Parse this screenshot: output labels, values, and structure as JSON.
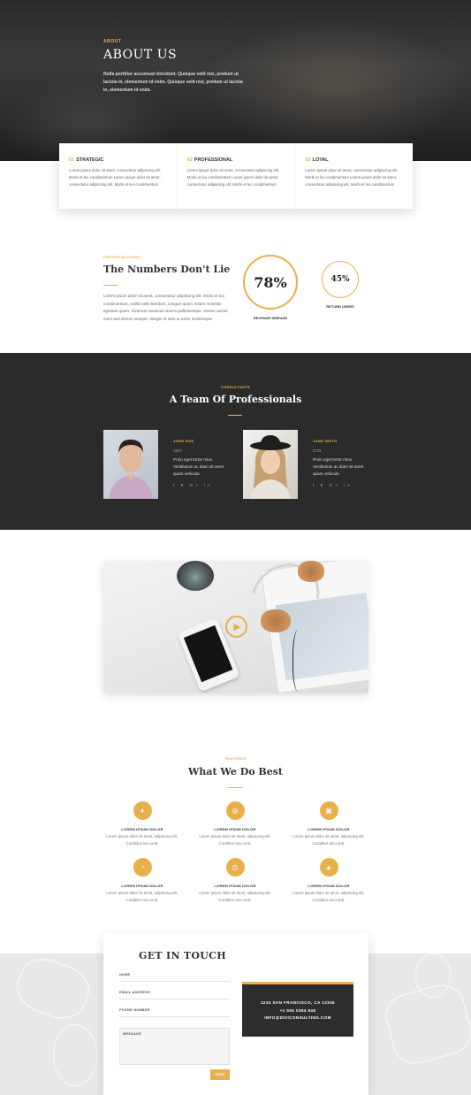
{
  "hero": {
    "eyebrow": "ABOUT",
    "title": "ABOUT US",
    "lead": "Nulla porttitor accumsan tincidunt. Quisque velit nisi, pretium ut lacinia in, elementum id enim. Quisque velit nisi, pretium ut lacinia in, elementum id enim."
  },
  "values": [
    {
      "num": "01",
      "title": "STRATEGIC",
      "body": "Lorem ipsum dolor sit amet, consectetur adipiscing elit. Morbi et leo condimentum Lorem ipsum dolor sit amet, consectetur adipiscing elit. Morbi et leo condimentum"
    },
    {
      "num": "02",
      "title": "PROFESSIONAL",
      "body": "Lorem ipsum dolor sit amet, consectetur adipiscing elit. Morbi et leo condimentum Lorem ipsum dolor sit amet, consectetur adipiscing elit. Morbi et leo condimentum"
    },
    {
      "num": "03",
      "title": "LOYAL",
      "body": "Lorem ipsum dolor sit amet, consectetur adipiscing elit. Morbi et leo condimentum Lorem ipsum dolor sit amet, consectetur adipiscing elit. Morbi et leo condimentum"
    }
  ],
  "numbers": {
    "eyebrow": "PROVEN SUCCESS",
    "title": "The Numbers Don't Lie",
    "body": "Lorem ipsum dolor sit amet, consectetur adipiscing elit. Morbi et leo condimentum, mollis velit interdum, congue quam. Etiam molestie egestas quam. Vivamus maximus viverra pellentesque. Donec auctor enim sed dictum semper. Integer id sem ut tortor scelerisque",
    "stats": [
      {
        "value": "78%",
        "label": "REVENUE INREASE"
      },
      {
        "value": "45%",
        "label": "RETURN USERS"
      }
    ]
  },
  "team": {
    "eyebrow": "CONSULTANTS",
    "title": "A Team Of Professionals",
    "members": [
      {
        "name": "JOHN DOE",
        "role": "CEO",
        "bio": "Proin eget tortor risus. Vestibulum ac diam sit amet quam vehicula",
        "social": "f  ♥  G+  in"
      },
      {
        "name": "JANE SMITH",
        "role": "CTO",
        "bio": "Proin eget tortor risus. Vestibulum ac diam sit amet quam vehicula",
        "social": "f  ♥  G+  in"
      }
    ]
  },
  "video": {
    "play_icon": "play-icon"
  },
  "features": {
    "eyebrow": "FEATURES",
    "title": "What We Do Best",
    "items": [
      {
        "icon": "award-icon",
        "glyph": "♦",
        "title": "LOREM IPSUM DOLOR",
        "desc": "Lorem ipsum dolor sit amet, adipiscing elit. Curabitur arcu erat."
      },
      {
        "icon": "target-icon",
        "glyph": "◎",
        "title": "LOREM IPSUM DOLOR",
        "desc": "Lorem ipsum dolor sit amet, adipiscing elit. Curabitur arcu erat."
      },
      {
        "icon": "calendar-icon",
        "glyph": "▣",
        "title": "LOREM IPSUM DOLOR",
        "desc": "Lorem ipsum dolor sit amet, adipiscing elit. Curabitur arcu erat."
      },
      {
        "icon": "pie-chart-icon",
        "glyph": "◔",
        "title": "LOREM IPSUM DOLOR",
        "desc": "Lorem ipsum dolor sit amet, adipiscing elit. Curabitur arcu erat."
      },
      {
        "icon": "clock-icon",
        "glyph": "◷",
        "title": "LOREM IPSUM DOLOR",
        "desc": "Lorem ipsum dolor sit amet, adipiscing elit. Curabitur arcu erat."
      },
      {
        "icon": "rocket-icon",
        "glyph": "▲",
        "title": "LOREM IPSUM DOLOR",
        "desc": "Lorem ipsum dolor sit amet, adipiscing elit. Curabitur arcu erat."
      }
    ]
  },
  "contact": {
    "title": "GET IN TOUCH",
    "fields": [
      "NAME",
      "EMAIL ADDRESS",
      "PHONE NUMBER"
    ],
    "message": "MESSAGE",
    "send": "SEND",
    "info": [
      "1234 SAN FRANCISCO, CA 12345",
      "+1 555 0394 948",
      "INFO@DIVICONSULTING.COM"
    ]
  },
  "colors": {
    "accent": "#e8b04b",
    "dark": "#2b2b2b"
  }
}
